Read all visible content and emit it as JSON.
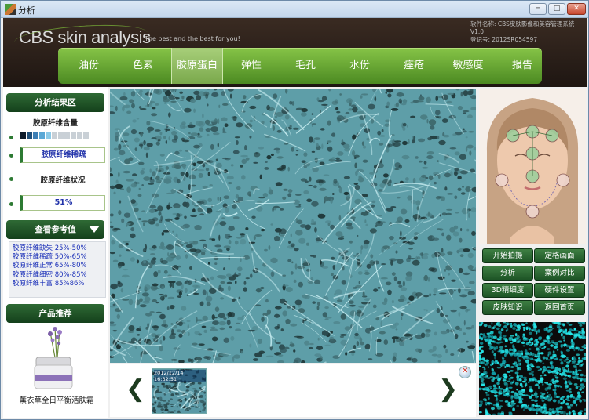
{
  "window": {
    "title": "分析"
  },
  "header": {
    "brand": "CBS skin analysis",
    "slogan": "The best and the best for you!",
    "software_name": "软件名称: CBS皮肤影像和美容管理系统V1.0",
    "registration": "登记号: 2012SR054597"
  },
  "nav": {
    "tabs": [
      "油份",
      "色素",
      "胶原蛋白",
      "弹性",
      "毛孔",
      "水份",
      "痤疮",
      "敏感度",
      "报告"
    ],
    "active_index": 2
  },
  "left": {
    "result_header": "分析结果区",
    "content_label": "胶原纤维含量",
    "content_level_value": "胶原纤维稀疏",
    "status_label": "胶原纤维状况",
    "status_value": "51%",
    "reference_header": "查看参考值",
    "reference_items": [
      "胶原纤维缺失 25%-50%",
      "胶原纤维稀疏 50%-65%",
      "胶原纤维正常 65%-80%",
      "胶原纤维细密 80%-85%",
      "胶原纤维丰富 85%86%"
    ],
    "product_header": "产品推荐",
    "product_name": "薰衣草全日平衡活肤霜",
    "swatch_colors": [
      "#0d1a2a",
      "#1f4f7a",
      "#3d7fb5",
      "#5aa8d6",
      "#8ccbe8",
      "#c9d0d6",
      "#c9d0d6",
      "#c9d0d6",
      "#c9d0d6",
      "#c9d0d6",
      "#c9d0d6"
    ]
  },
  "thumbs": {
    "timestamp": "2012/12/14 16:32:51"
  },
  "right": {
    "buttons": [
      "开始拍摄",
      "定格画面",
      "分析",
      "案例对比",
      "3D精细度",
      "硬件设置",
      "皮肤知识",
      "返回首页"
    ]
  },
  "colors": {
    "accent_green": "#4c8a22",
    "dark_green": "#14401b",
    "skin_cyan": "#5e9ea8"
  }
}
